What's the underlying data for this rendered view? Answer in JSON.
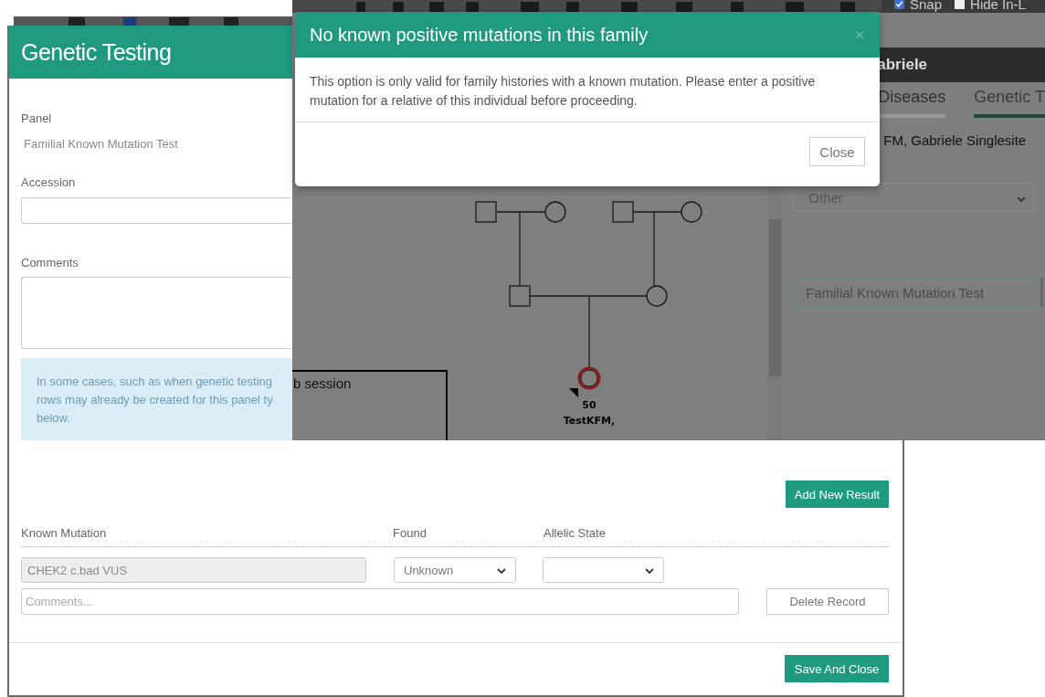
{
  "genetic_testing_dialog": {
    "title": "Genetic Testing",
    "panel_label": "Panel",
    "panel_value": "Familial Known Mutation Test",
    "accession_label": "Accession",
    "comments_label": "Comments",
    "info_lines": [
      "In some cases, such as when genetic testing",
      "rows may already be created for this panel ty",
      "below."
    ],
    "add_button": "Add New Result",
    "columns": [
      "Known Mutation",
      "Found",
      "Allelic State"
    ],
    "results": [
      {
        "known_mutation": "CHEK2 c.bad VUS",
        "found": "Unknown",
        "comments_placeholder": "Comments...",
        "delete_button": "Delete Record"
      }
    ],
    "save_button": "Save And Close"
  },
  "background_app": {
    "toolbar": {
      "checkboxes": [
        {
          "label": "Snap",
          "checked": true
        },
        {
          "label": "Hide In-L",
          "checked": false
        }
      ]
    },
    "note_text": "b session",
    "pedigree": {
      "proband": {
        "age": "50",
        "name": "TestKFM,"
      }
    },
    "patient_header": "abriele",
    "tabs": [
      {
        "label": "Diseases",
        "selected": false
      },
      {
        "label": "Genetic T",
        "selected": true
      }
    ],
    "patient_name": "FM, Gabriele Singlesite",
    "type_select": "Other",
    "panel_field": "Familial Known Mutation Test"
  },
  "alert_modal": {
    "title": "No known positive mutations in this family",
    "close_icon": "×",
    "message": "This option is only valid for family histories with a known mutation. Please enter a positive mutation for a relative of this individual before proceeding.",
    "close_button": "Close"
  }
}
